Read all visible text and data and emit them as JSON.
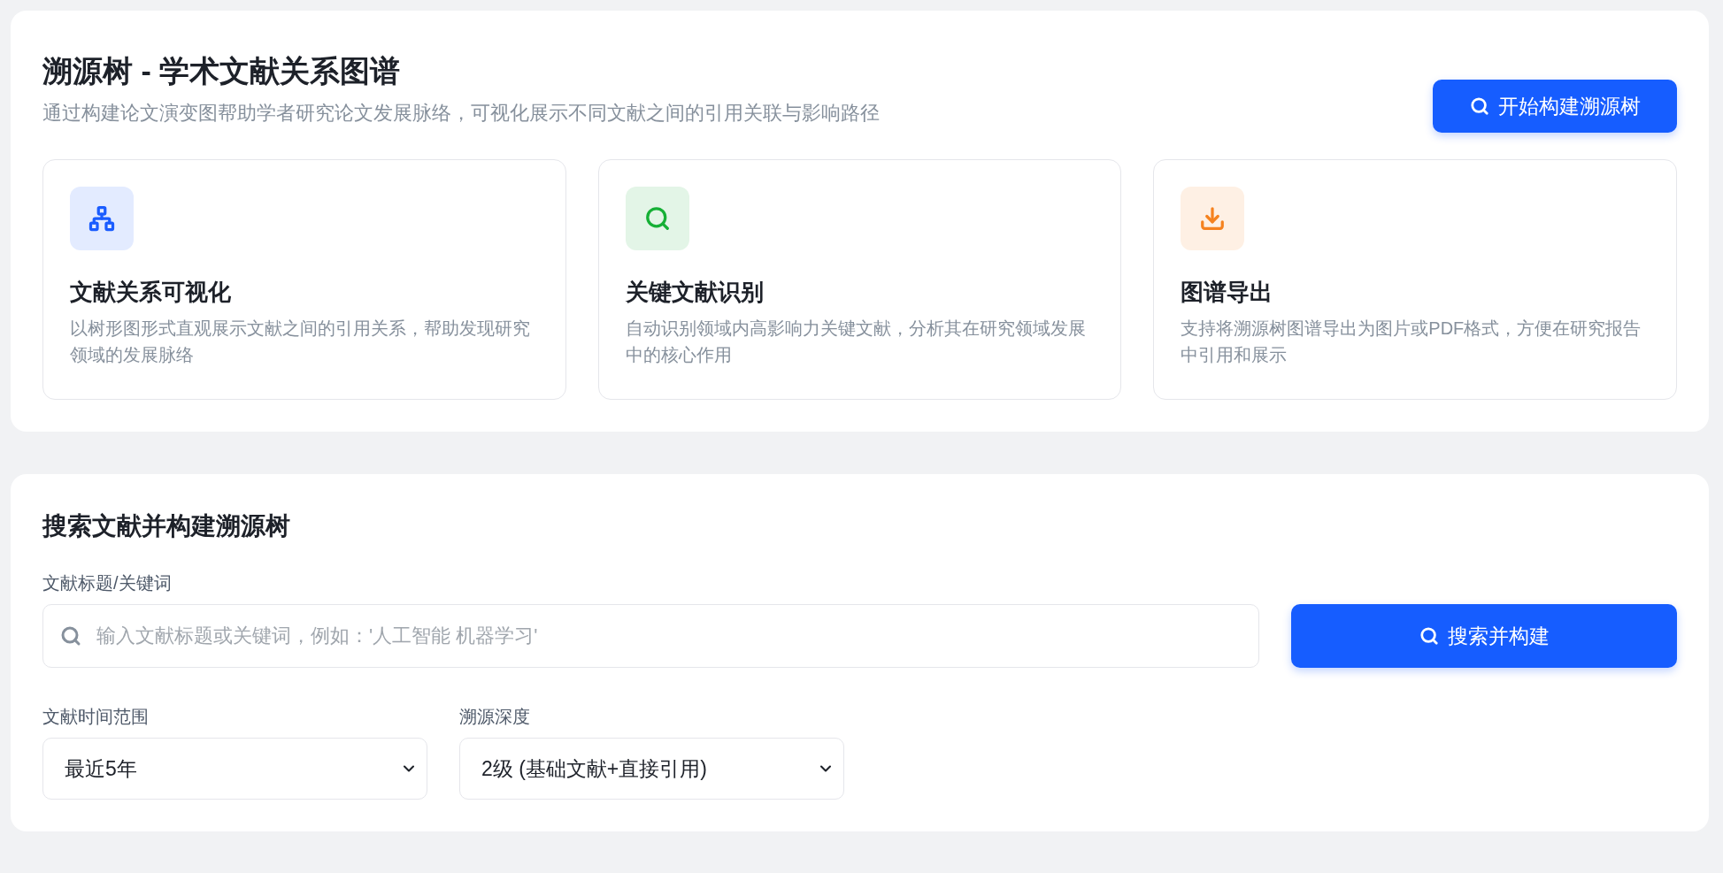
{
  "intro": {
    "title": "溯源树 - 学术文献关系图谱",
    "subtitle": "通过构建论文演变图帮助学者研究论文发展脉络，可视化展示不同文献之间的引用关联与影响路径",
    "action_button": "开始构建溯源树"
  },
  "features": [
    {
      "kind": "hierarchy",
      "color": "#1a5cff",
      "title": "文献关系可视化",
      "description": "以树形图形式直观展示文献之间的引用关系，帮助发现研究领域的发展脉络"
    },
    {
      "kind": "search",
      "color": "#16b036",
      "title": "关键文献识别",
      "description": "自动识别领域内高影响力关键文献，分析其在研究领域发展中的核心作用"
    },
    {
      "kind": "export",
      "color": "#f5821f",
      "title": "图谱导出",
      "description": "支持将溯源树图谱导出为图片或PDF格式，方便在研究报告中引用和展示"
    }
  ],
  "search_panel": {
    "heading": "搜索文献并构建溯源树",
    "query_label": "文献标题/关键词",
    "query_placeholder": "输入文献标题或关键词，例如：'人工智能 机器学习'",
    "search_button": "搜索并构建",
    "filters": [
      {
        "label": "文献时间范围",
        "value": "最近5年"
      },
      {
        "label": "溯源深度",
        "value": "2级 (基础文献+直接引用)"
      }
    ]
  }
}
